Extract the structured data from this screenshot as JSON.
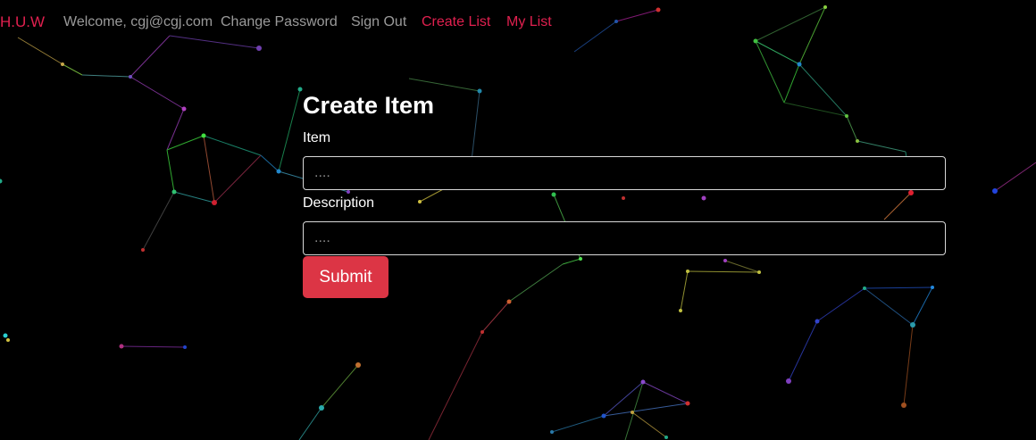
{
  "nav": {
    "brand": "H.U.W",
    "welcome": "Welcome, cgj@cgj.com",
    "change_password": "Change Password",
    "sign_out": "Sign Out",
    "create_list": "Create List",
    "my_list": "My List"
  },
  "form": {
    "title": "Create Item",
    "item_label": "Item",
    "item_placeholder": "....",
    "item_value": "",
    "description_label": "Description",
    "description_placeholder": "....",
    "description_value": "",
    "submit_label": "Submit"
  },
  "colors": {
    "background": "#000000",
    "accent": "#e0204f",
    "nav_muted": "#9a9a9a",
    "submit": "#dc3545"
  }
}
